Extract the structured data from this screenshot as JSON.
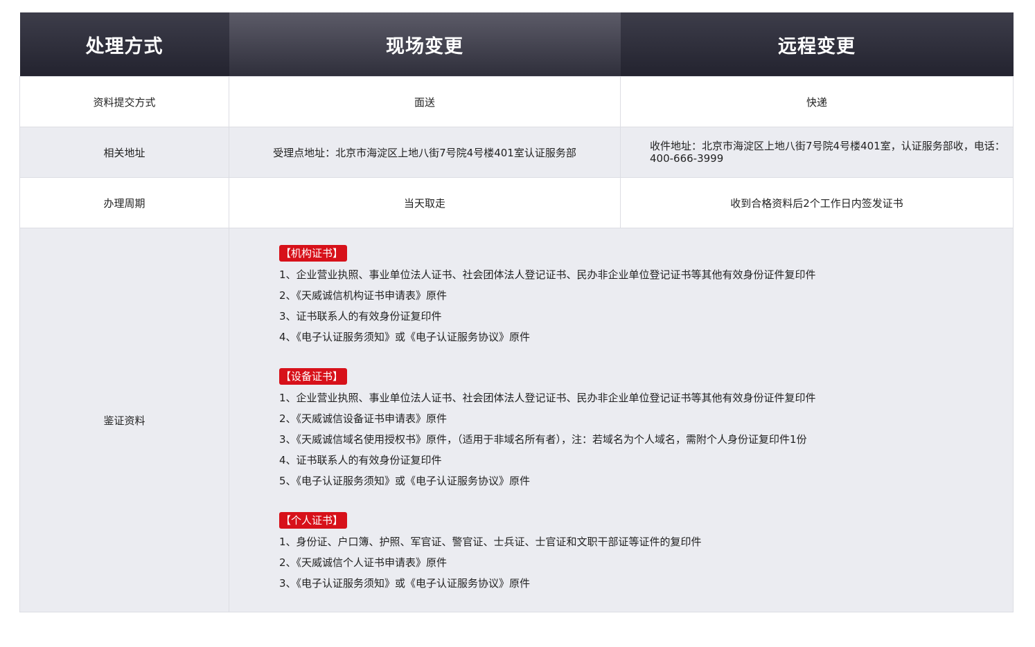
{
  "header": {
    "col1": "处理方式",
    "col2": "现场变更",
    "col3": "远程变更"
  },
  "rows": {
    "submission": {
      "label": "资料提交方式",
      "onsite": "面送",
      "remote": "快递"
    },
    "address": {
      "label": "相关地址",
      "onsite": "受理点地址：北京市海淀区上地八街7号院4号楼401室认证服务部",
      "remote": "收件地址：北京市海淀区上地八街7号院4号楼401室，认证服务部收，电话：400-666-3999"
    },
    "period": {
      "label": "办理周期",
      "onsite": "当天取走",
      "remote": "收到合格资料后2个工作日内签发证书"
    },
    "documents": {
      "label": "鉴证资料",
      "groups": [
        {
          "tag": "【机构证书】",
          "items": [
            "1、企业营业执照、事业单位法人证书、社会团体法人登记证书、民办非企业单位登记证书等其他有效身份证件复印件",
            "2、《天威诚信机构证书申请表》原件",
            "3、证书联系人的有效身份证复印件",
            "4、《电子认证服务须知》或《电子认证服务协议》原件"
          ]
        },
        {
          "tag": "【设备证书】",
          "items": [
            "1、企业营业执照、事业单位法人证书、社会团体法人登记证书、民办非企业单位登记证书等其他有效身份证件复印件",
            "2、《天威诚信设备证书申请表》原件",
            "3、《天威诚信域名使用授权书》原件，（适用于非域名所有者），注：若域名为个人域名，需附个人身份证复印件1份",
            "4、证书联系人的有效身份证复印件",
            "5、《电子认证服务须知》或《电子认证服务协议》原件"
          ]
        },
        {
          "tag": "【个人证书】",
          "items": [
            "1、身份证、户口簿、护照、军官证、警官证、士兵证、士官证和文职干部证等证件的复印件",
            "2、《天威诚信个人证书申请表》原件",
            "3、《电子认证服务须知》或《电子认证服务协议》原件"
          ]
        }
      ]
    }
  },
  "colors": {
    "header_dark": "#2b2b37",
    "header_mid": "#4a4956",
    "row_grey": "#ebecf1",
    "tag_red": "#d7111a"
  }
}
